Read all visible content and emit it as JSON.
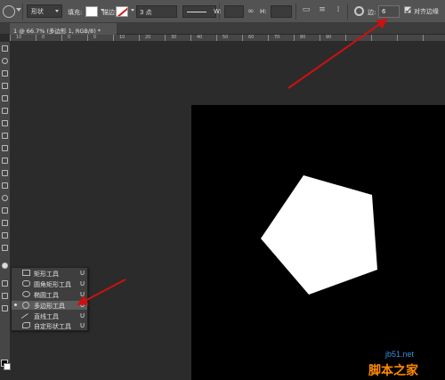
{
  "options_bar": {
    "mode": "形状",
    "fill_label": "填充:",
    "stroke_label": "描边:",
    "stroke_width": "3 点",
    "width_label": "W:",
    "height_label": "H:",
    "sides_label": "边:",
    "sides_value": "6",
    "align_edges_label": "对齐边缘",
    "fill_color": "#ffffff",
    "stroke_color": "#d01818"
  },
  "document_tab": {
    "title": "1 @ 66.7% (多边形 1, RGB/8) *"
  },
  "ruler_ticks": [
    "10",
    "0",
    "0",
    "0",
    "10",
    "20",
    "30",
    "40",
    "50",
    "60",
    "70",
    "80",
    "90"
  ],
  "flyout": {
    "items": [
      {
        "label": "矩形工具",
        "shortcut": "U",
        "icon": "rectangle-icon",
        "selected": false
      },
      {
        "label": "圆角矩形工具",
        "shortcut": "U",
        "icon": "rounded-rectangle-icon",
        "selected": false
      },
      {
        "label": "椭圆工具",
        "shortcut": "U",
        "icon": "ellipse-icon",
        "selected": false
      },
      {
        "label": "多边形工具",
        "shortcut": "U",
        "icon": "polygon-icon",
        "selected": true
      },
      {
        "label": "直线工具",
        "shortcut": "U",
        "icon": "line-icon",
        "selected": false
      },
      {
        "label": "自定形状工具",
        "shortcut": "U",
        "icon": "custom-shape-icon",
        "selected": false
      }
    ]
  },
  "canvas": {
    "background": "#000000",
    "shape_color": "#ffffff",
    "shape": "pentagon"
  },
  "annotation_color": "#cc1111",
  "watermark": {
    "url": "jb51.net",
    "name": "脚本之家"
  }
}
